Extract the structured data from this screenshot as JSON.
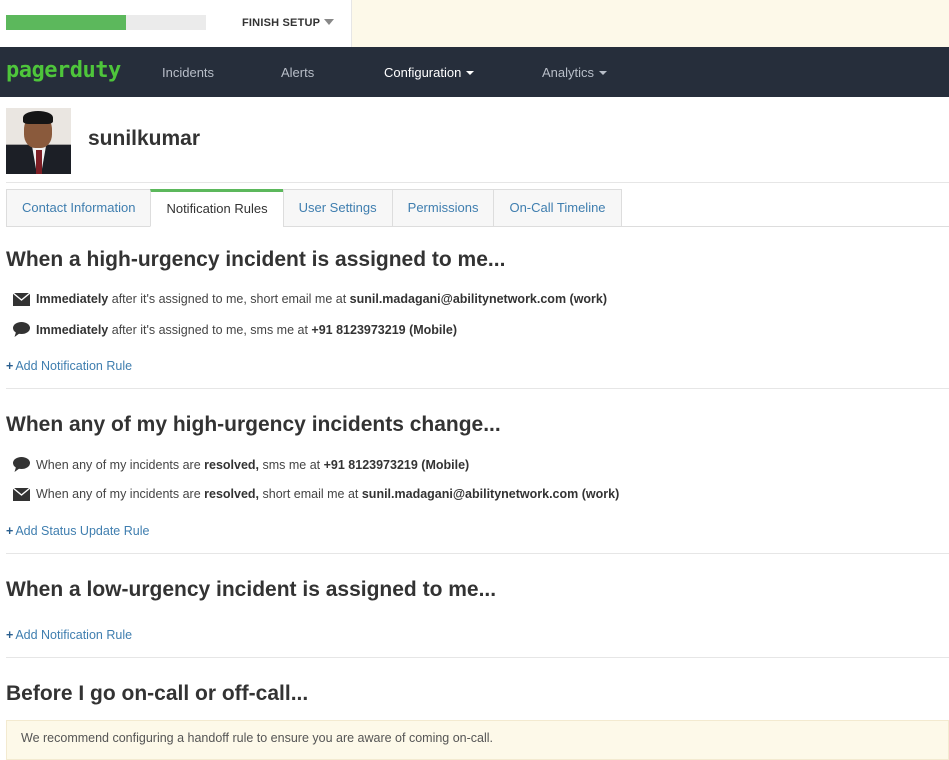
{
  "setup": {
    "progress_fraction": 0.6,
    "finish_label": "FINISH SETUP",
    "colors": {
      "progress_fill": "#5cb85c",
      "banner_bg": "#fdf9e9"
    }
  },
  "nav": {
    "logo": "pagerduty",
    "items": [
      {
        "label": "Incidents"
      },
      {
        "label": "Alerts"
      },
      {
        "label": "Configuration"
      },
      {
        "label": "Analytics"
      }
    ],
    "colors": {
      "bg": "#262e3b",
      "logo": "#4ec53b"
    }
  },
  "profile": {
    "username": "sunilkumar"
  },
  "tabs": [
    {
      "label": "Contact Information"
    },
    {
      "label": "Notification Rules"
    },
    {
      "label": "User Settings"
    },
    {
      "label": "Permissions"
    },
    {
      "label": "On-Call Timeline"
    }
  ],
  "sections": {
    "high_assigned": {
      "title": "When a high-urgency incident is assigned to me...",
      "rules": [
        {
          "icon": "envelope-icon",
          "lead": "Immediately",
          "text": " after it's assigned to me, short email me at ",
          "target": "sunil.madagani@abilitynetwork.com (work)"
        },
        {
          "icon": "chat-bubble-icon",
          "lead": "Immediately",
          "text": " after it's assigned to me, sms me at ",
          "target": "+91 8123973219 (Mobile)"
        }
      ],
      "add_link": "Add Notification Rule"
    },
    "high_change": {
      "title": "When any of my high-urgency incidents change...",
      "rules": [
        {
          "icon": "chat-bubble-icon",
          "pre": "When any of my incidents are ",
          "status": "resolved,",
          "text": " sms me at ",
          "target": "+91 8123973219 (Mobile)"
        },
        {
          "icon": "envelope-icon",
          "pre": "When any of my incidents are ",
          "status": "resolved,",
          "text": " short email me at ",
          "target": "sunil.madagani@abilitynetwork.com (work)"
        }
      ],
      "add_link": "Add Status Update Rule"
    },
    "low_assigned": {
      "title": "When a low-urgency incident is assigned to me...",
      "add_link": "Add Notification Rule"
    },
    "oncall": {
      "title": "Before I go on-call or off-call...",
      "recommend": "We recommend configuring a handoff rule to ensure you are aware of coming on-call."
    }
  }
}
